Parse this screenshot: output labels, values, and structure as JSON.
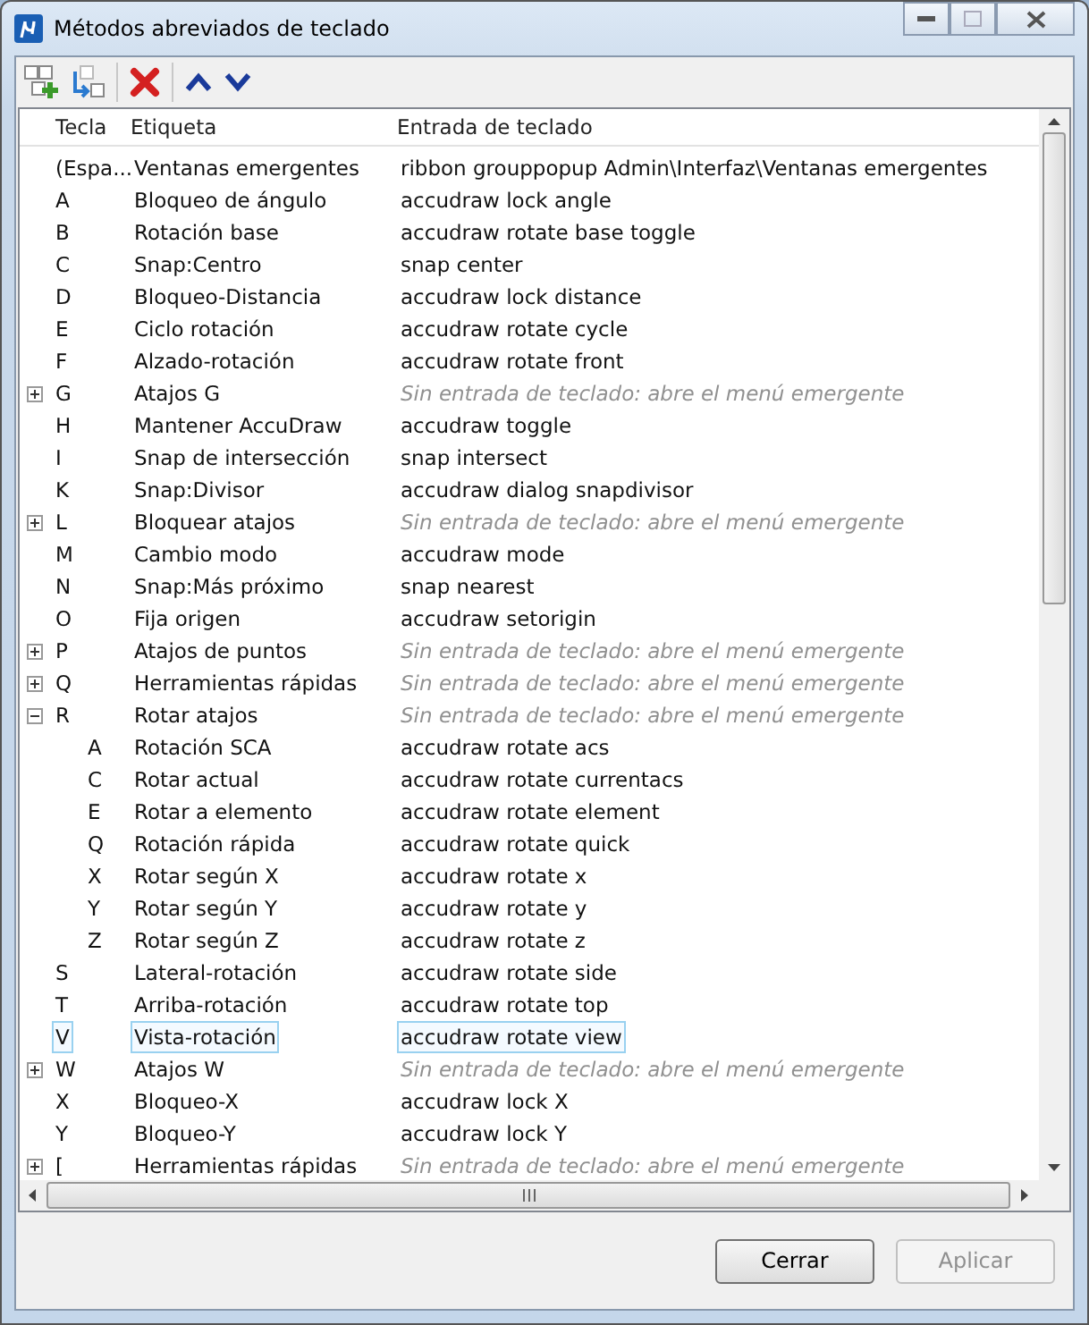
{
  "window": {
    "title": "Métodos abreviados de teclado"
  },
  "table": {
    "columns": [
      "Tecla",
      "Etiqueta",
      "Entrada de teclado"
    ],
    "rows": [
      {
        "key": "(Espa...",
        "label": "Ventanas emergentes",
        "kind": "command",
        "command": "ribbon grouppopup Admin\\Interfaz\\Ventanas emergentes",
        "selected": false
      },
      {
        "key": "A",
        "label": "Bloqueo de ángulo",
        "kind": "command",
        "command": "accudraw lock angle",
        "selected": false
      },
      {
        "key": "B",
        "label": "Rotación base",
        "kind": "command",
        "command": "accudraw rotate base toggle",
        "selected": false
      },
      {
        "key": "C",
        "label": "Snap:Centro",
        "kind": "command",
        "command": "snap center",
        "selected": false
      },
      {
        "key": "D",
        "label": "Bloqueo-Distancia",
        "kind": "command",
        "command": "accudraw lock distance",
        "selected": false
      },
      {
        "key": "E",
        "label": "Ciclo rotación",
        "kind": "command",
        "command": "accudraw rotate cycle",
        "selected": false
      },
      {
        "key": "F",
        "label": "Alzado-rotación",
        "kind": "command",
        "command": "accudraw rotate front",
        "selected": false
      },
      {
        "key": "G",
        "label": "Atajos G",
        "kind": "menu",
        "command": "Sin entrada de teclado: abre el menú emergente",
        "expanded": false,
        "selected": false
      },
      {
        "key": "H",
        "label": "Mantener AccuDraw",
        "kind": "command",
        "command": "accudraw toggle",
        "selected": false
      },
      {
        "key": "I",
        "label": "Snap de intersección",
        "kind": "command",
        "command": "snap intersect",
        "selected": false
      },
      {
        "key": "K",
        "label": "Snap:Divisor",
        "kind": "command",
        "command": "accudraw dialog snapdivisor",
        "selected": false
      },
      {
        "key": "L",
        "label": "Bloquear atajos",
        "kind": "menu",
        "command": "Sin entrada de teclado: abre el menú emergente",
        "expanded": false,
        "selected": false
      },
      {
        "key": "M",
        "label": "Cambio modo",
        "kind": "command",
        "command": "accudraw mode",
        "selected": false
      },
      {
        "key": "N",
        "label": "Snap:Más próximo",
        "kind": "command",
        "command": "snap nearest",
        "selected": false
      },
      {
        "key": "O",
        "label": "Fija origen",
        "kind": "command",
        "command": "accudraw setorigin",
        "selected": false
      },
      {
        "key": "P",
        "label": "Atajos de puntos",
        "kind": "menu",
        "command": "Sin entrada de teclado: abre el menú emergente",
        "expanded": false,
        "selected": false
      },
      {
        "key": "Q",
        "label": "Herramientas rápidas",
        "kind": "menu",
        "command": "Sin entrada de teclado: abre el menú emergente",
        "expanded": false,
        "selected": false
      },
      {
        "key": "R",
        "label": "Rotar atajos",
        "kind": "menu",
        "command": "Sin entrada de teclado: abre el menú emergente",
        "expanded": true,
        "selected": false,
        "children": [
          {
            "key": "A",
            "label": "Rotación SCA",
            "kind": "command",
            "command": "accudraw rotate acs",
            "selected": false
          },
          {
            "key": "C",
            "label": "Rotar actual",
            "kind": "command",
            "command": "accudraw rotate currentacs",
            "selected": false
          },
          {
            "key": "E",
            "label": "Rotar a elemento",
            "kind": "command",
            "command": "accudraw rotate element",
            "selected": false
          },
          {
            "key": "Q",
            "label": "Rotación rápida",
            "kind": "command",
            "command": "accudraw rotate quick",
            "selected": false
          },
          {
            "key": "X",
            "label": "Rotar según X",
            "kind": "command",
            "command": "accudraw rotate x",
            "selected": false
          },
          {
            "key": "Y",
            "label": "Rotar según Y",
            "kind": "command",
            "command": "accudraw rotate y",
            "selected": false
          },
          {
            "key": "Z",
            "label": "Rotar según Z",
            "kind": "command",
            "command": "accudraw rotate z",
            "selected": false
          }
        ]
      },
      {
        "key": "S",
        "label": "Lateral-rotación",
        "kind": "command",
        "command": "accudraw rotate side",
        "selected": false
      },
      {
        "key": "T",
        "label": "Arriba-rotación",
        "kind": "command",
        "command": "accudraw rotate top",
        "selected": false
      },
      {
        "key": "V",
        "label": "Vista-rotación",
        "kind": "command",
        "command": "accudraw rotate view",
        "selected": true
      },
      {
        "key": "W",
        "label": "Atajos W",
        "kind": "menu",
        "command": "Sin entrada de teclado: abre el menú emergente",
        "expanded": false,
        "selected": false
      },
      {
        "key": "X",
        "label": "Bloqueo-X",
        "kind": "command",
        "command": "accudraw lock X",
        "selected": false
      },
      {
        "key": "Y",
        "label": "Bloqueo-Y",
        "kind": "command",
        "command": "accudraw lock Y",
        "selected": false
      },
      {
        "key": "[",
        "label": "Herramientas rápidas",
        "kind": "menu",
        "command": "Sin entrada de teclado: abre el menú emergente",
        "expanded": false,
        "selected": false
      }
    ]
  },
  "buttons": [
    {
      "label": "Cerrar",
      "disabled": false
    },
    {
      "label": "Aplicar",
      "disabled": true
    }
  ]
}
